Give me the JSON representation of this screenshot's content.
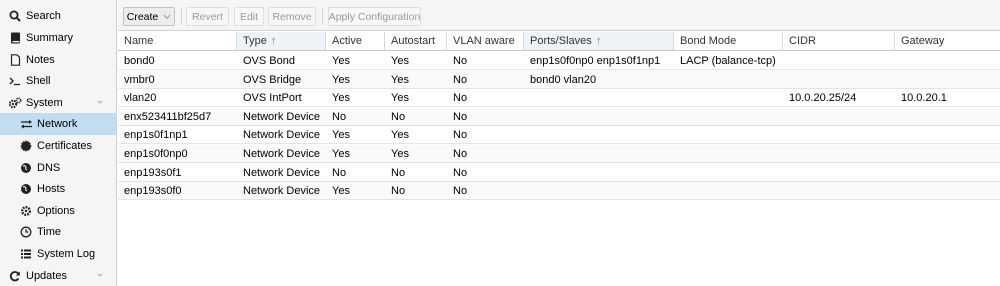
{
  "sidebar": {
    "items": [
      {
        "label": "Search",
        "icon": "search-icon",
        "selected": false
      },
      {
        "label": "Summary",
        "icon": "book-icon",
        "selected": false
      },
      {
        "label": "Notes",
        "icon": "note-icon",
        "selected": false
      },
      {
        "label": "Shell",
        "icon": "terminal-icon",
        "selected": false
      },
      {
        "label": "System",
        "icon": "gears-icon",
        "selected": false,
        "expandable": true
      },
      {
        "label": "Network",
        "icon": "exchange-icon",
        "selected": true
      },
      {
        "label": "Certificates",
        "icon": "certificate-icon",
        "selected": false
      },
      {
        "label": "DNS",
        "icon": "globe-icon",
        "selected": false
      },
      {
        "label": "Hosts",
        "icon": "globe-icon",
        "selected": false
      },
      {
        "label": "Options",
        "icon": "gear-icon",
        "selected": false
      },
      {
        "label": "Time",
        "icon": "clock-icon",
        "selected": false
      },
      {
        "label": "System Log",
        "icon": "list-icon",
        "selected": false
      },
      {
        "label": "Updates",
        "icon": "refresh-icon",
        "selected": false,
        "expandable": true
      }
    ]
  },
  "toolbar": {
    "create": "Create",
    "revert": "Revert",
    "edit": "Edit",
    "remove": "Remove",
    "apply": "Apply Configuration"
  },
  "grid": {
    "columns": [
      "Name",
      "Type",
      "Active",
      "Autostart",
      "VLAN aware",
      "Ports/Slaves",
      "Bond Mode",
      "CIDR",
      "Gateway"
    ],
    "sorted_columns": [
      "Type",
      "Ports/Slaves"
    ],
    "rows": [
      [
        "bond0",
        "OVS Bond",
        "Yes",
        "Yes",
        "No",
        "enp1s0f0np0 enp1s0f1np1",
        "LACP (balance-tcp)",
        "",
        ""
      ],
      [
        "vmbr0",
        "OVS Bridge",
        "Yes",
        "Yes",
        "No",
        "bond0 vlan20",
        "",
        "",
        ""
      ],
      [
        "vlan20",
        "OVS IntPort",
        "Yes",
        "Yes",
        "No",
        "",
        "",
        "10.0.20.25/24",
        "10.0.20.1"
      ],
      [
        "enx523411bf25d7",
        "Network Device",
        "No",
        "No",
        "No",
        "",
        "",
        "",
        ""
      ],
      [
        "enp1s0f1np1",
        "Network Device",
        "Yes",
        "Yes",
        "No",
        "",
        "",
        "",
        ""
      ],
      [
        "enp1s0f0np0",
        "Network Device",
        "Yes",
        "Yes",
        "No",
        "",
        "",
        "",
        ""
      ],
      [
        "enp193s0f1",
        "Network Device",
        "No",
        "No",
        "No",
        "",
        "",
        "",
        ""
      ],
      [
        "enp193s0f0",
        "Network Device",
        "Yes",
        "No",
        "No",
        "",
        "",
        "",
        ""
      ]
    ]
  },
  "colors": {
    "selected_bg": "#c2ddf2",
    "sidebar_bg": "#f5f5f5"
  }
}
